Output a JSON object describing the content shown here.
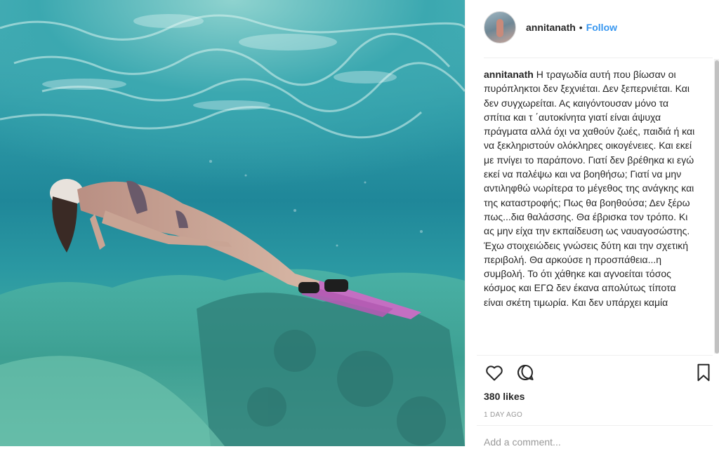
{
  "post": {
    "username": "annitanath",
    "separator": "•",
    "follow_label": "Follow",
    "caption_username": "annitanath",
    "caption_text": "Η τραγωδία αυτή που βίωσαν οι πυρόπληκτοι δεν ξεχνιέται. Δεν ξεπερνιέται. Και δεν συγχωρείται. Ας καιγόντουσαν μόνο τα σπίτια και τ ΄αυτοκίνητα γιατί είναι άψυχα πράγματα αλλά όχι να χαθούν ζωές, παιδιά ή και να ξεκληριστούν ολόκληρες οικογένειες. Και εκεί με πνίγει το παράπονο. Γιατί δεν βρέθηκα κι εγώ εκεί να παλέψω και να βοηθήσω; Γιατί να μην αντιληφθώ νωρίτερα το μέγεθος της ανάγκης και της καταστροφής; Πως θα βοηθούσα; Δεν ξέρω πως...δια θαλάσσης. Θα έβρισκα τον τρόπο. Κι ας μην είχα την εκπαίδευση ως ναυαγοσώστης. Έχω στοιχειώδεις γνώσεις δύτη και την σχετική περιβολή. Θα αρκούσε η προσπάθεια...η συμβολή. Το ότι χάθηκε και αγνοείται τόσος κόσμος και ΕΓΩ δεν έκανα απολύτως τίποτα είναι σκέτη τιμωρία. Και δεν υπάρχει καμία",
    "likes": "380 likes",
    "time_ago": "1 DAY AGO",
    "comment_placeholder": "Add a comment..."
  },
  "icons": {
    "like": "heart-icon",
    "comment": "comment-bubble-icon",
    "save": "bookmark-icon"
  },
  "colors": {
    "follow_blue": "#3897f0",
    "text": "#262626",
    "muted": "#999999",
    "water": "#2e9aa7"
  }
}
